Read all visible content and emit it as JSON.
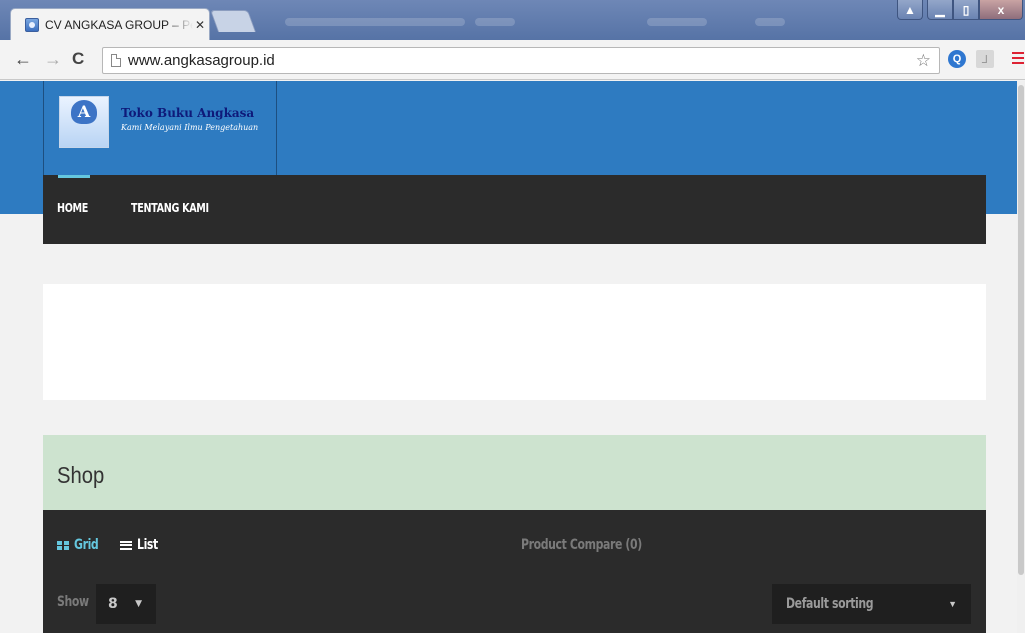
{
  "browser": {
    "tab_title": "CV ANGKASA GROUP – Pemesanan",
    "tab_close": "✕",
    "url": "www.angkasagroup.id",
    "window_buttons": {
      "minimize": "▁",
      "maximize": "▯",
      "close": "x"
    }
  },
  "site": {
    "brand_name": "Toko Buku Angkasa",
    "brand_tagline": "Kami Melayani Ilmu Pengetahuan",
    "nav": {
      "home": "HOME",
      "about": "TENTANG KAMI"
    }
  },
  "shop": {
    "title": "Shop",
    "view_grid": "Grid",
    "view_list": "List",
    "compare": "Product Compare (0)",
    "show_label": "Show",
    "per_page": "8",
    "sorting": "Default sorting"
  },
  "colors": {
    "header_blue": "#2e7bc1",
    "nav_dark": "#2b2b2b",
    "accent_cyan": "#65c7de",
    "shop_head_green": "#cde3cf"
  },
  "icons": {
    "back": "arrow-left-icon",
    "forward": "arrow-right-icon",
    "reload": "reload-icon",
    "star": "bookmark-star-icon",
    "menu": "hamburger-menu-icon"
  }
}
